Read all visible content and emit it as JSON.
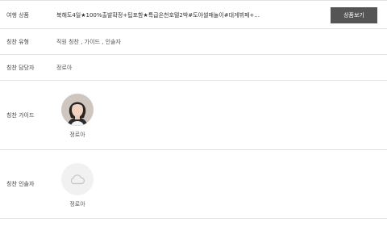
{
  "product_row": {
    "label": "여행 상품",
    "title": "북해도4일★100%출발확정+팁포함★특급온천호텔2박#도야썰매놀이#대게뷔페+...",
    "button_label": "상품보기"
  },
  "type_row": {
    "label": "칭찬 유형",
    "value": "직원 칭찬 , 가이드 , 인솔자"
  },
  "manager_row": {
    "label": "칭찬 담당자",
    "value": "정로아"
  },
  "guide_row": {
    "label": "칭찬 가이드",
    "name": "정로아"
  },
  "escort_row": {
    "label": "칭찬 인솔자",
    "name": "정로아"
  },
  "colors": {
    "button_bg": "#555555",
    "border": "#e2e2e2"
  },
  "icons": {
    "guide_avatar": "person-photo",
    "escort_avatar": "cloud-icon"
  }
}
